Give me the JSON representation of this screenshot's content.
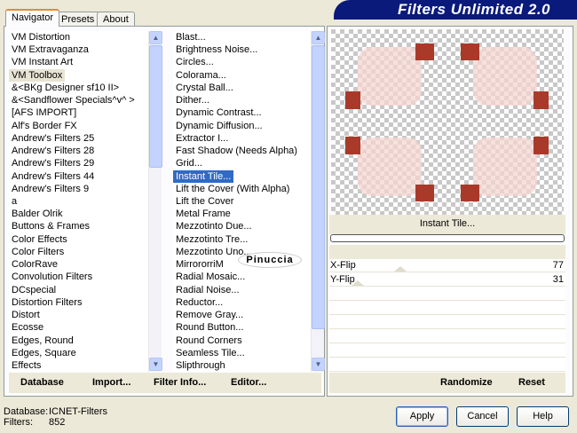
{
  "title": "Filters Unlimited 2.0",
  "tabs": [
    {
      "label": "Navigator"
    },
    {
      "label": "Presets"
    },
    {
      "label": "About"
    }
  ],
  "categories": [
    "VM Distortion",
    "VM Extravaganza",
    "VM Instant Art",
    "VM Toolbox",
    "&<BKg Designer sf10 II>",
    "&<Sandflower Specials^v^ >",
    "[AFS IMPORT]",
    "Alf's Border FX",
    "Andrew's Filters 25",
    "Andrew's Filters 28",
    "Andrew's Filters 29",
    "Andrew's Filters 44",
    "Andrew's Filters 9",
    "a",
    "Balder Olrik",
    "Buttons & Frames",
    "Color Effects",
    "Color Filters",
    "ColorRave",
    "Convolution Filters",
    "DCspecial",
    "Distortion Filters",
    "Distort",
    "Ecosse",
    "Edges, Round",
    "Edges, Square",
    "Effects"
  ],
  "selected_category": "VM Toolbox",
  "filters": [
    "Blast...",
    "Brightness Noise...",
    "Circles...",
    "Colorama...",
    "Crystal Ball...",
    "Dither...",
    "Dynamic Contrast...",
    "Dynamic Diffusion...",
    "Extractor I...",
    "Fast Shadow (Needs Alpha)",
    "Grid...",
    "Instant Tile...",
    "Lift the Cover (With Alpha)",
    "Lift the Cover",
    "Metal Frame",
    "Mezzotinto Due...",
    "Mezzotinto Tre...",
    "Mezzotinto Uno...",
    "MirrororriM",
    "Radial Mosaic...",
    "Radial Noise...",
    "Reductor...",
    "Remove Gray...",
    "Round Button...",
    "Round Corners",
    "Seamless Tile...",
    "Slipthrough"
  ],
  "selected_filter": "Instant Tile...",
  "watermark": "Pinuccia",
  "bottom_buttons": {
    "database": "Database",
    "import": "Import...",
    "filter_info": "Filter Info...",
    "editor": "Editor..."
  },
  "preview": {
    "filter_name": "Instant Tile...",
    "progress": 0
  },
  "sliders": [
    {
      "label": "X-Flip",
      "value": "77",
      "max": 255
    },
    {
      "label": "Y-Flip",
      "value": "31",
      "max": 255
    }
  ],
  "randomize": "Randomize",
  "reset": "Reset",
  "status": {
    "database_label": "Database:",
    "database_value": "ICNET-Filters",
    "filters_label": "Filters:",
    "filters_value": "852"
  },
  "buttons": {
    "apply": "Apply",
    "cancel": "Cancel",
    "help": "Help"
  },
  "colors": {
    "banner": "#0a1a7a",
    "selection": "#316ac5",
    "tile_red": "#a93a2a",
    "tile_pink": "#f5d6d2"
  }
}
